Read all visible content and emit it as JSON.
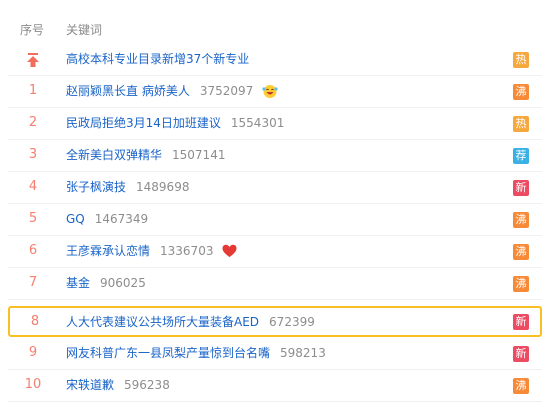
{
  "header": {
    "rank_label": "序号",
    "keyword_label": "关键词"
  },
  "colors": {
    "hot": "#f6a83c",
    "boil": "#f78a38",
    "new": "#ec4b62",
    "rec": "#39b1e4",
    "highlight_border": "#f8c022",
    "link": "#1a64c8",
    "rank": "#f47f6e"
  },
  "pinned": {
    "icon": "pin-top-icon",
    "keyword": "高校本科专业目录新增37个新专业",
    "badge": "热",
    "badge_type": "hot"
  },
  "items": [
    {
      "rank": "1",
      "keyword": "赵丽颖黑长直 病娇美人",
      "count": "3752097",
      "emoji": "laughing-face-icon",
      "badge": "沸",
      "badge_type": "boil"
    },
    {
      "rank": "2",
      "keyword": "民政局拒绝3月14日加班建议",
      "count": "1554301",
      "badge": "热",
      "badge_type": "hot"
    },
    {
      "rank": "3",
      "keyword": "全新美白双弹精华",
      "count": "1507141",
      "badge": "荐",
      "badge_type": "rec"
    },
    {
      "rank": "4",
      "keyword": "张子枫演技",
      "count": "1489698",
      "badge": "新",
      "badge_type": "new"
    },
    {
      "rank": "5",
      "keyword": "GQ",
      "count": "1467349",
      "badge": "沸",
      "badge_type": "boil"
    },
    {
      "rank": "6",
      "keyword": "王彦霖承认恋情",
      "count": "1336703",
      "emoji": "heart-icon",
      "badge": "沸",
      "badge_type": "boil"
    },
    {
      "rank": "7",
      "keyword": "基金",
      "count": "906025",
      "badge": "沸",
      "badge_type": "boil"
    },
    {
      "rank": "8",
      "keyword": "人大代表建议公共场所大量装备AED",
      "count": "672399",
      "badge": "新",
      "badge_type": "new",
      "highlighted": true
    },
    {
      "rank": "9",
      "keyword": "网友科普广东一县凤梨产量惊到台名嘴",
      "count": "598213",
      "badge": "新",
      "badge_type": "new"
    },
    {
      "rank": "10",
      "keyword": "宋轶道歉",
      "count": "596238",
      "badge": "沸",
      "badge_type": "boil"
    }
  ]
}
